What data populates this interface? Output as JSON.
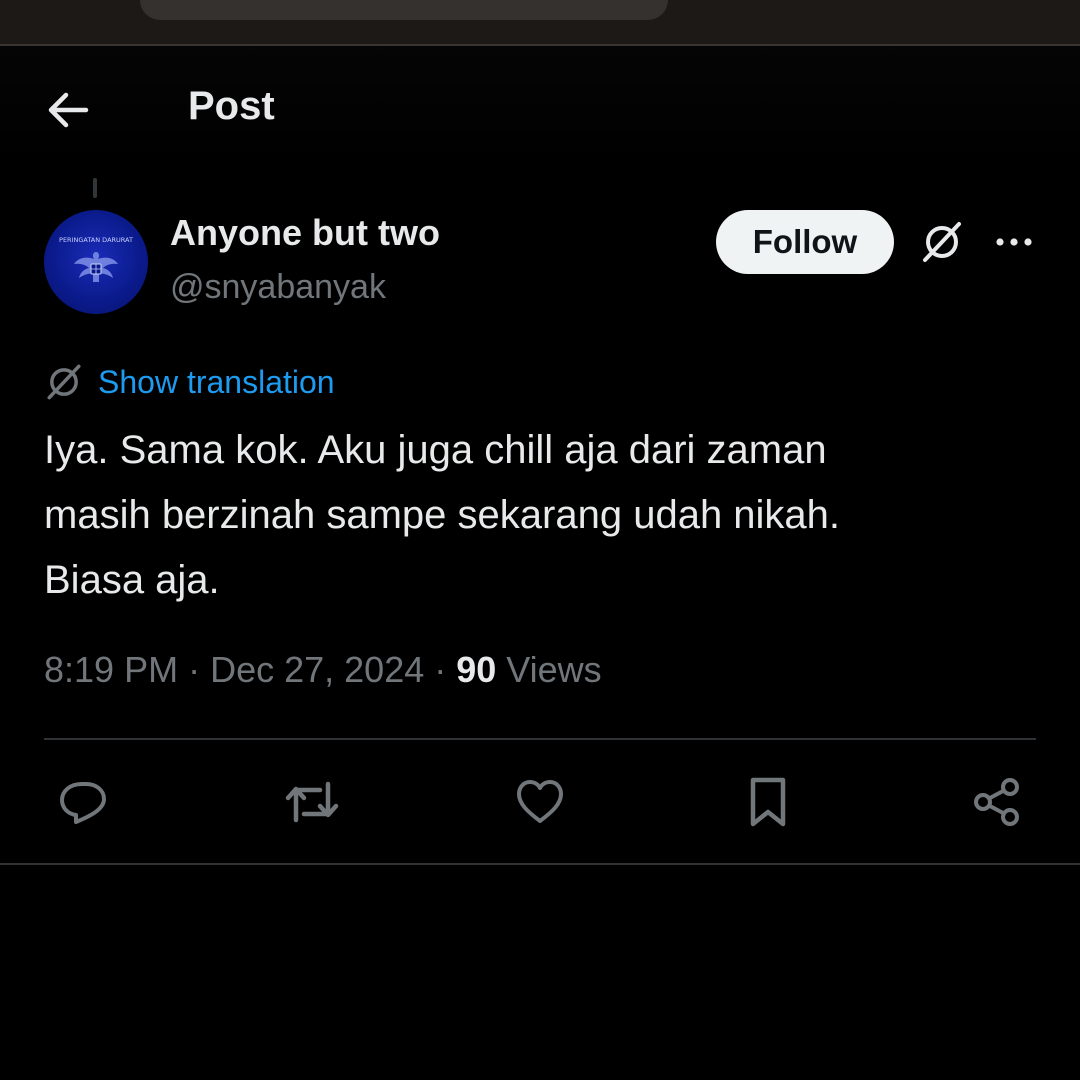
{
  "header": {
    "title": "Post"
  },
  "author": {
    "display_name": "Anyone but two",
    "handle": "@snyabanyak",
    "avatar_text": "PERINGATAN DARURAT"
  },
  "follow_label": "Follow",
  "translation": {
    "label": "Show translation"
  },
  "post": {
    "lines": [
      "Iya. Sama kok. Aku juga chill aja dari zaman",
      "masih berzinah sampe sekarang udah nikah.",
      "Biasa aja."
    ]
  },
  "meta": {
    "time": "8:19 PM",
    "date": "Dec 27, 2024",
    "views_count": "90",
    "views_label": "Views"
  },
  "colors": {
    "background": "#000000",
    "text": "#e7e9ea",
    "muted": "#71767b",
    "link": "#1d9bf0",
    "follow_bg": "#eff3f4"
  },
  "icons": [
    "back-arrow-icon",
    "grok-icon",
    "more-icon",
    "translate-icon",
    "reply-icon",
    "repost-icon",
    "like-icon",
    "bookmark-icon",
    "share-icon"
  ]
}
